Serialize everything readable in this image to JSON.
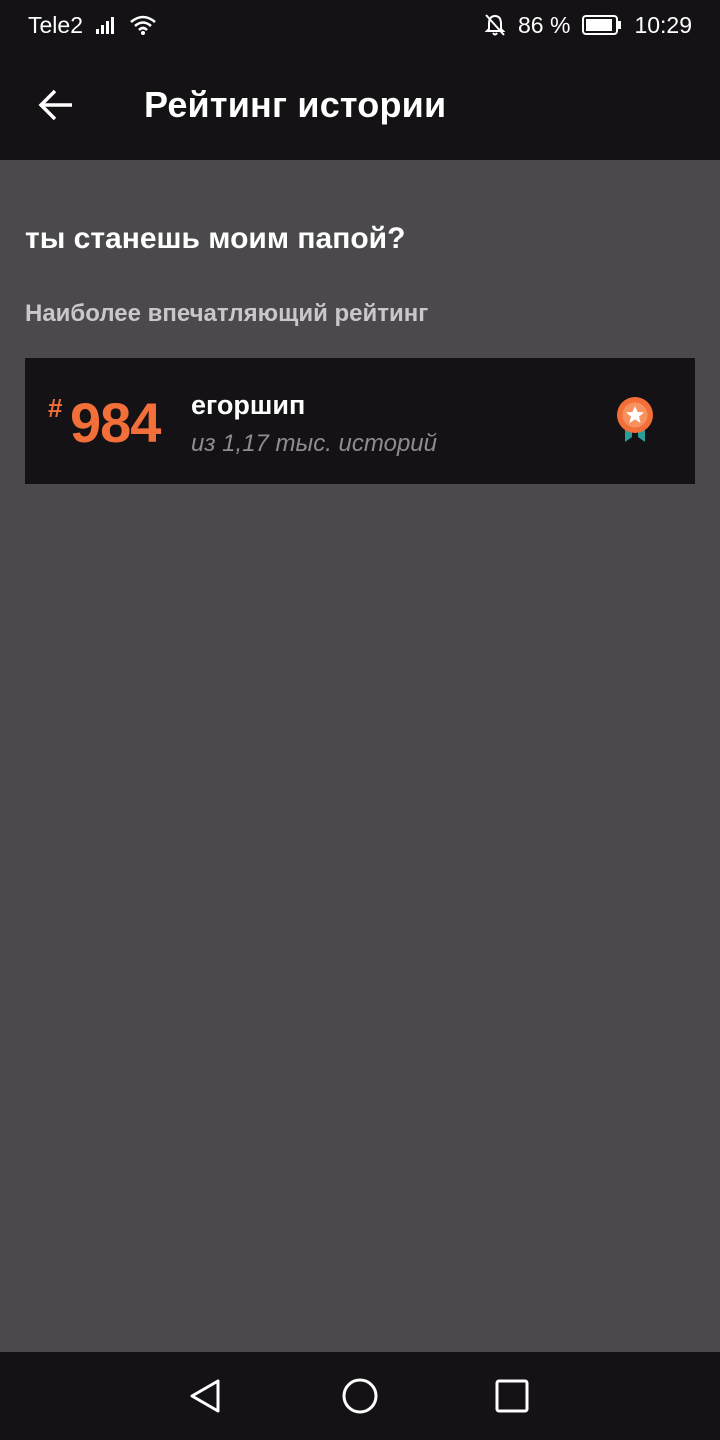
{
  "status_bar": {
    "carrier": "Tele2",
    "battery": "86 %",
    "time": "10:29",
    "icons": [
      "signal-icon",
      "wifi-icon",
      "bell-off-icon",
      "battery-icon"
    ]
  },
  "app_bar": {
    "back_icon": "arrow-left-icon",
    "title": "Рейтинг истории"
  },
  "story": {
    "title": "ты станешь моим папой?"
  },
  "ranking": {
    "section_label": "Наиболее впечатляющий рейтинг",
    "hash": "#",
    "rank": "984",
    "tag": "егоршип",
    "subtitle": "из 1,17 тыс. историй",
    "badge_icon": "award-ribbon-icon"
  },
  "nav_bar": {
    "icons": [
      "back-triangle-icon",
      "home-circle-icon",
      "recents-square-icon"
    ]
  },
  "colors": {
    "bar_background": "#141215",
    "page_background": "#4b494c",
    "accent": "#f26f3a",
    "badge_ribbon": "#2a9d9a"
  }
}
